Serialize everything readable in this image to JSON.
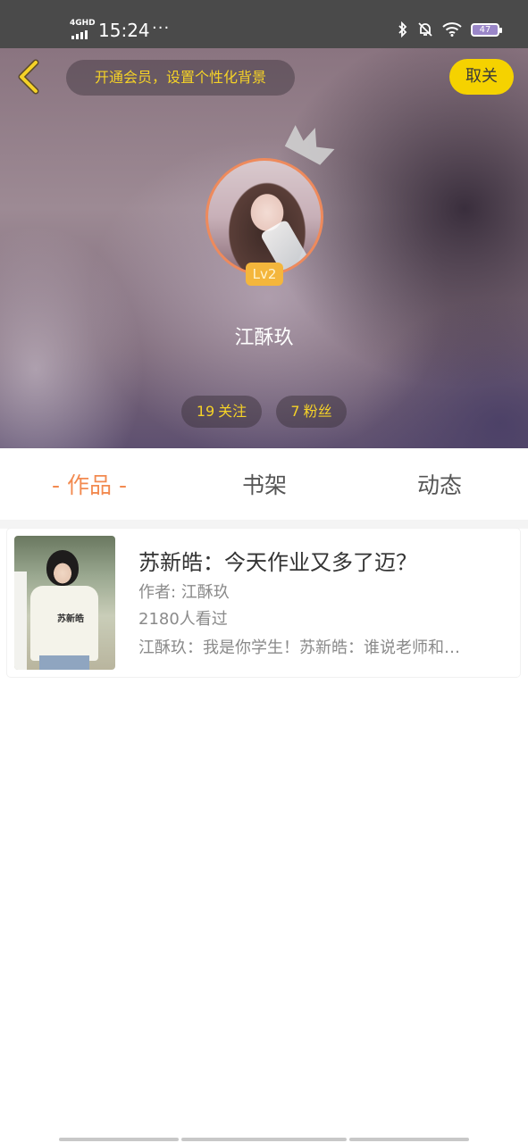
{
  "status_bar": {
    "network": "4GHD",
    "time": "15:24",
    "more": "···",
    "battery": "47"
  },
  "header": {
    "vip_tip": "开通会员，设置个性化背景",
    "follow_button": "取关"
  },
  "profile": {
    "level": "Lv2",
    "name": "江酥玖",
    "following_count": "19",
    "following_label": "关注",
    "fans_count": "7",
    "fans_label": "粉丝"
  },
  "tabs": [
    {
      "label": "作品",
      "active": true
    },
    {
      "label": "书架",
      "active": false
    },
    {
      "label": "动态",
      "active": false
    }
  ],
  "works": [
    {
      "title": "苏新皓：今天作业又多了迈？",
      "author": "作者: 江酥玖",
      "views": "2180人看过",
      "summary": "江酥玖：我是你学生！苏新皓：谁说老师和…",
      "cover_shirt_text": "苏新皓"
    }
  ],
  "colors": {
    "accent_orange": "#f28a50",
    "follow_yellow": "#f5d200",
    "tip_text": "#f5d227"
  }
}
